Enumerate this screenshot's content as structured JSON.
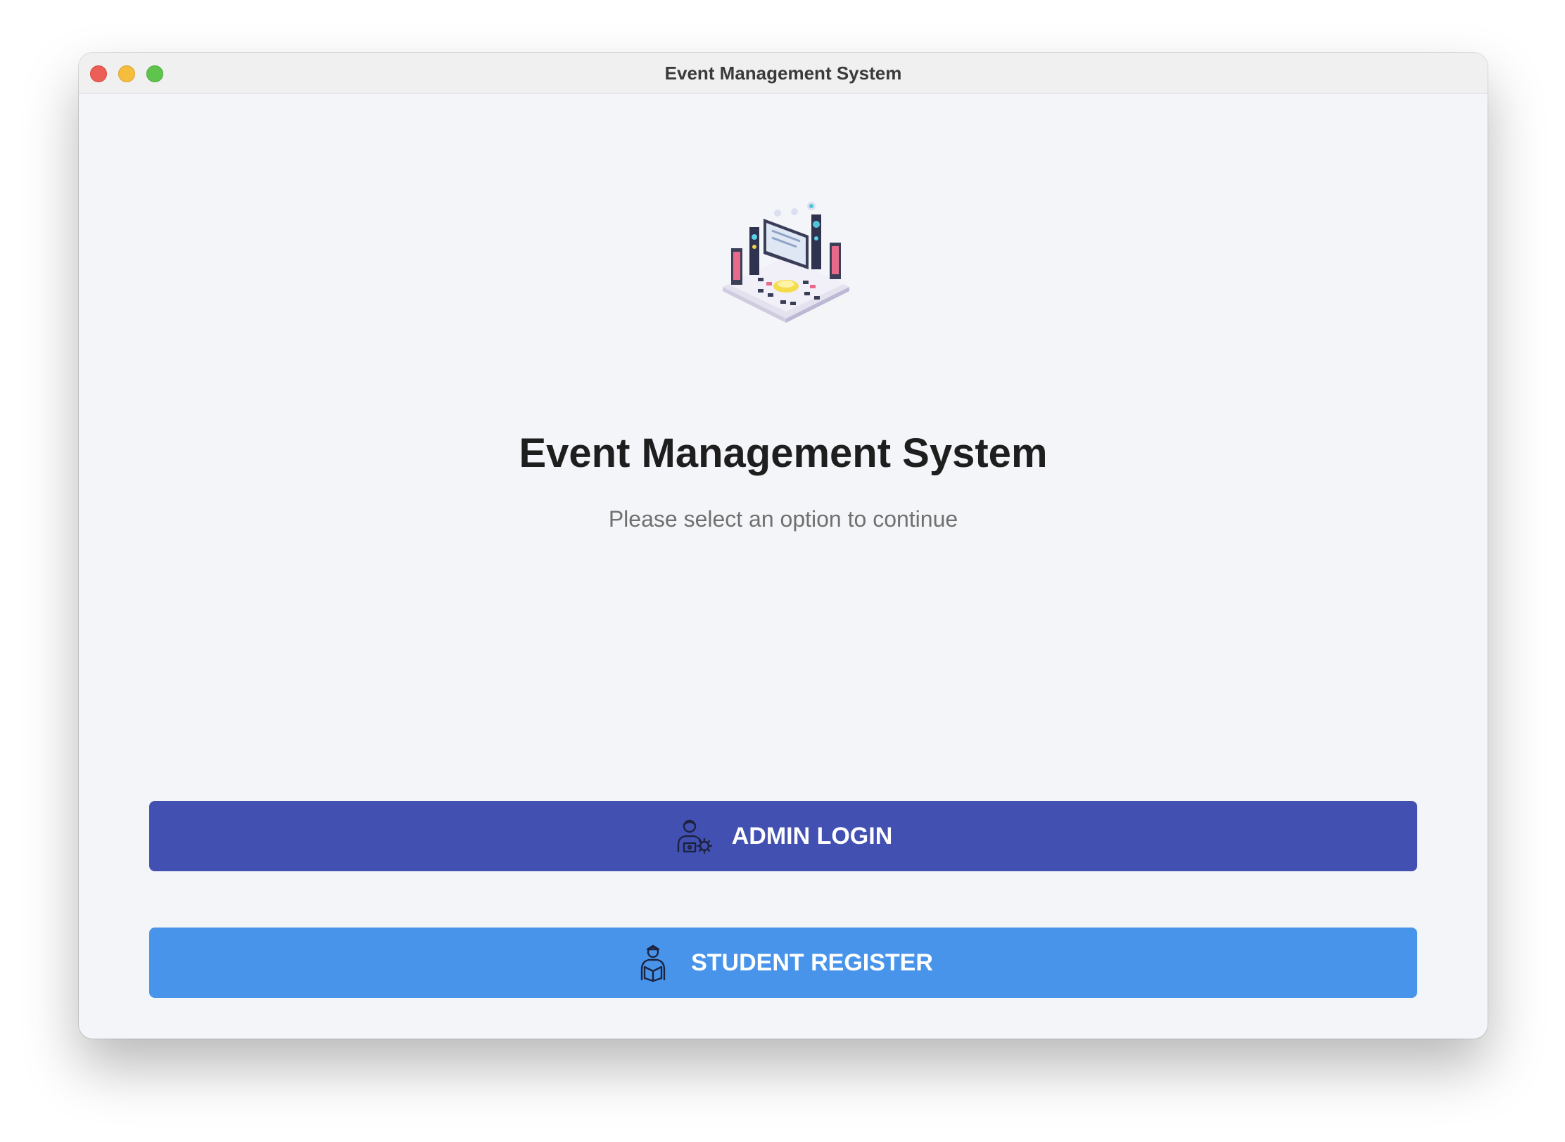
{
  "window": {
    "title": "Event Management System"
  },
  "main": {
    "heading": "Event Management System",
    "subheading": "Please select an option to continue",
    "hero_icon": "event-stage-illustration"
  },
  "buttons": {
    "admin": {
      "label": "ADMIN LOGIN",
      "icon": "admin-user-gear-icon",
      "color": "#4250b2"
    },
    "student": {
      "label": "STUDENT REGISTER",
      "icon": "student-reading-icon",
      "color": "#4794ea"
    }
  },
  "colors": {
    "background": "#f4f5f9",
    "titlebar": "#f0f0f0",
    "heading": "#1e1e1e",
    "subheading": "#707070"
  }
}
